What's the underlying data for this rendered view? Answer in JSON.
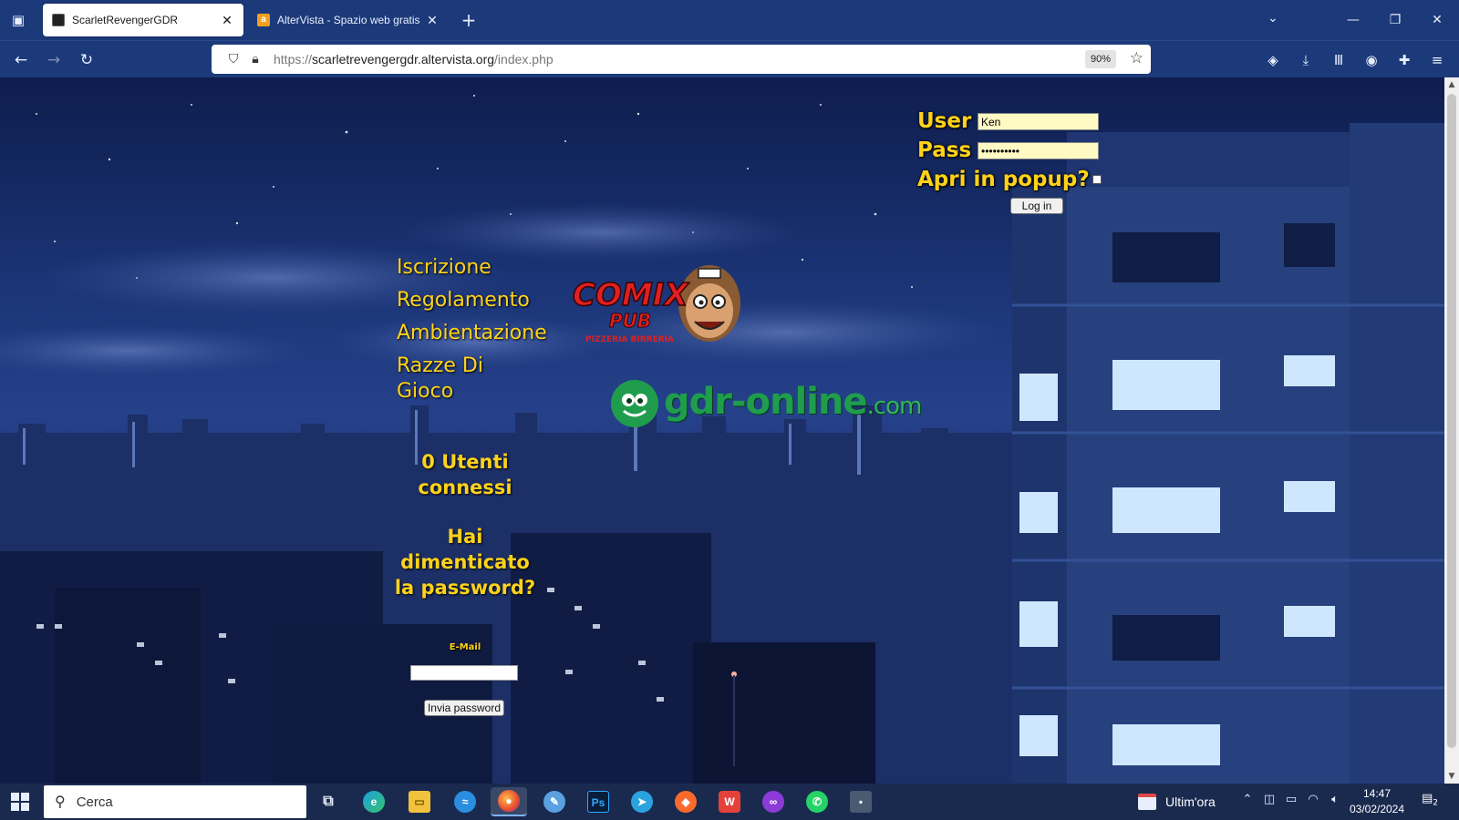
{
  "browser": {
    "tabs": [
      {
        "label": "ScarletRevengerGDR",
        "active": true
      },
      {
        "label": "AlterVista - Spazio web gratis",
        "active": false,
        "favicon_letter": "a"
      }
    ],
    "url": {
      "protocol": "https://",
      "host": "scarletrevengergdr.altervista.org",
      "path": "/index.php"
    },
    "zoom": "90%"
  },
  "login": {
    "user_label": "User",
    "user_value": "Ken",
    "pass_label": "Pass",
    "pass_value": "••••••••••",
    "popup_label": "Apri in popup?",
    "button": "Log in"
  },
  "menu": {
    "items": [
      "Iscrizione",
      "Regolamento",
      "Ambientazione",
      "Razze Di Gioco"
    ]
  },
  "logos": {
    "comix_main": "COMIX",
    "comix_sub": "PUB",
    "comix_tag": "PIZZERIA BIRRERIA",
    "gdr_main": "gdr-online",
    "gdr_suffix": ".com"
  },
  "users_online": "0 Utenti connessi",
  "recovery": {
    "title": "Hai dimenticato la password?",
    "email_label": "E-Mail",
    "email_value": "",
    "button": "Invia password"
  },
  "taskbar": {
    "search_placeholder": "Cerca",
    "apps": [
      "task-view",
      "edge",
      "file-explorer",
      "app-blue",
      "firefox",
      "app-paint",
      "photoshop",
      "telegram",
      "brave",
      "wps-office",
      "app-purple",
      "whatsapp",
      "app-misc"
    ],
    "news_label": "Ultim'ora",
    "time": "14:47",
    "date": "03/02/2024",
    "notifications": "2"
  },
  "colors": {
    "chrome": "#1c3a7a",
    "accent_text": "#ffd21a",
    "gdr_green": "#1f9d4d",
    "taskbar": "#1a2a4f"
  }
}
